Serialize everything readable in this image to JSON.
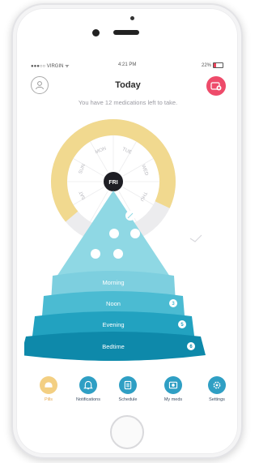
{
  "status_bar": {
    "carrier": "●●●○○ VIRGIN ᯤ",
    "time": "4:21 PM",
    "battery": "22%"
  },
  "header": {
    "title": "Today",
    "subtitle": "You have 12 medications left to take."
  },
  "days": [
    "MON",
    "TUE",
    "WED",
    "THU",
    "FRI",
    "SAT",
    "SUN"
  ],
  "selected_day": "FRI",
  "periods": [
    {
      "label": "Morning",
      "count": ""
    },
    {
      "label": "Noon",
      "count": "3"
    },
    {
      "label": "Evening",
      "count": "5"
    },
    {
      "label": "Bedtime",
      "count": "6"
    }
  ],
  "tabs": [
    {
      "label": "Pills",
      "icon": "pill-icon"
    },
    {
      "label": "Notifications",
      "icon": "bell-icon"
    },
    {
      "label": "Schedule",
      "icon": "list-icon"
    },
    {
      "label": "My meds",
      "icon": "camera-icon"
    },
    {
      "label": "Settings",
      "icon": "gear-icon"
    }
  ],
  "colors": {
    "accent": "#ee4b6a",
    "ring": "#f1d98f",
    "active_tab": "#f3cf82",
    "tab_icon": "#2f9fc4"
  }
}
